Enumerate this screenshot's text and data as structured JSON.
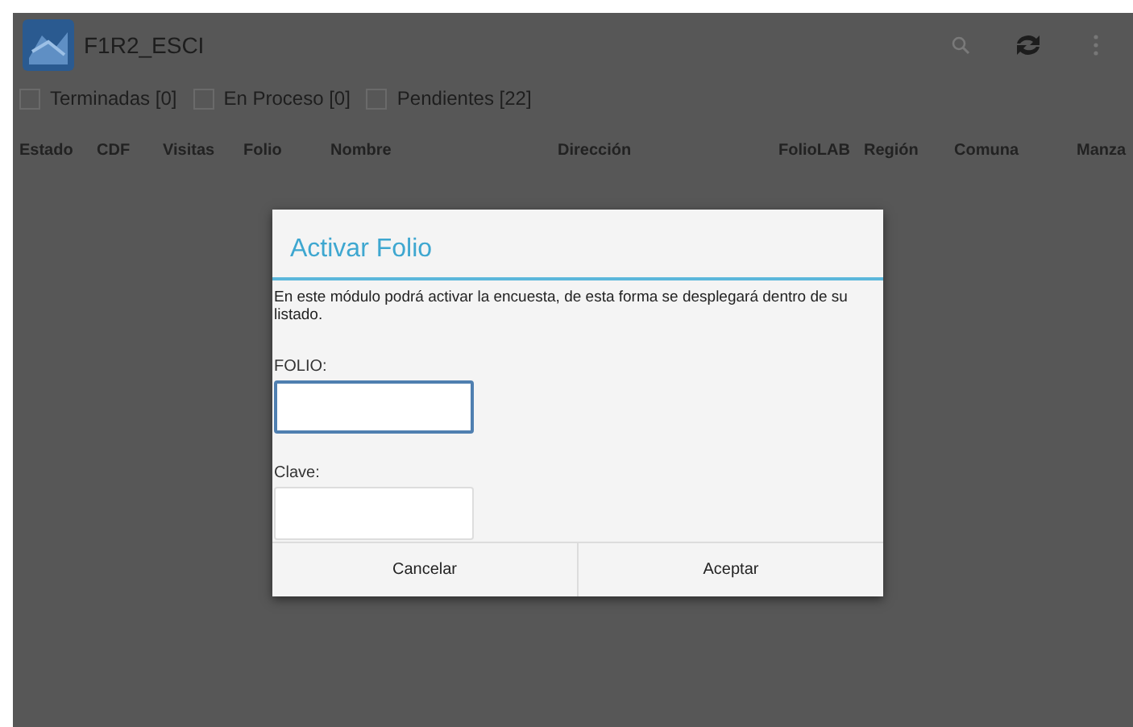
{
  "action_bar": {
    "title": "F1R2_ESCI"
  },
  "filters": [
    {
      "label": "Terminadas [0]",
      "checked": false
    },
    {
      "label": "En Proceso [0]",
      "checked": false
    },
    {
      "label": "Pendientes [22]",
      "checked": false
    }
  ],
  "table": {
    "columns": [
      "Estado",
      "CDF",
      "Visitas",
      "Folio",
      "Nombre",
      "Dirección",
      "FolioLAB",
      "Región",
      "Comuna",
      "Manza"
    ]
  },
  "dialog": {
    "title": "Activar Folio",
    "message": "En este módulo podrá activar la encuesta, de esta forma se desplegará dentro de su listado.",
    "fields": [
      {
        "label": "FOLIO:",
        "focused": true
      },
      {
        "label": "Clave:",
        "focused": false
      }
    ],
    "buttons": [
      "Cancelar",
      "Aceptar"
    ]
  }
}
